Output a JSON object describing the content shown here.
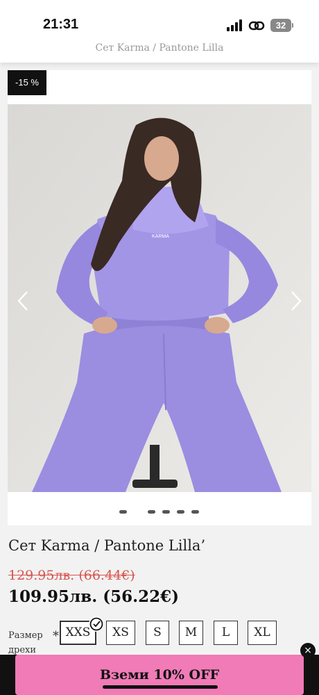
{
  "status_bar": {
    "time": "21:31",
    "battery": "32",
    "icons": [
      "signal-icon",
      "link-icon",
      "battery-icon"
    ]
  },
  "breadcrumb": "Сет Karma / Pantone Lilla",
  "product": {
    "discount_badge": "-15 %",
    "image_text": "KARMA",
    "gallery": {
      "slides": 5,
      "active_slide": 1
    },
    "title": "Сет Karma / Pantone Lilla’",
    "old_price": "129.95лв. (66.44€)",
    "new_price": "109.95лв. (56.22€)"
  },
  "size": {
    "label": "Размер дрехи",
    "required_mark": "*",
    "options": [
      "XXS",
      "XS",
      "S",
      "M",
      "L",
      "XL"
    ],
    "selected": "XXS"
  },
  "promo": {
    "label": "Вземи 10% OFF",
    "close": "×"
  },
  "colors": {
    "accent_pink": "#f07bb7",
    "price_red": "#d9534f",
    "lilac": "#9b8de0",
    "badge": "#111111"
  }
}
